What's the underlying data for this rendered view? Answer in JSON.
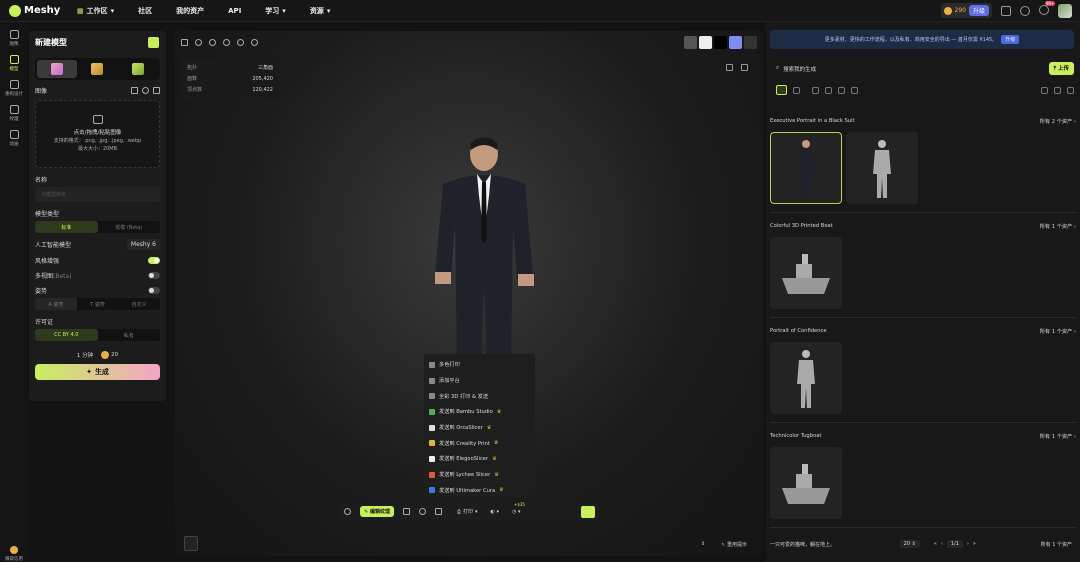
{
  "topbar": {
    "logo": "Meshy",
    "nav": [
      {
        "label": "工作区",
        "dropdown": true
      },
      {
        "label": "社区",
        "dropdown": false
      },
      {
        "label": "我的资产",
        "dropdown": false
      },
      {
        "label": "API",
        "dropdown": false
      },
      {
        "label": "学习",
        "dropdown": true
      },
      {
        "label": "资源",
        "dropdown": true
      }
    ],
    "credits": "290",
    "upgrade_label": "升级",
    "notification_badge": "99+"
  },
  "leftbar": {
    "items": [
      {
        "label": "图像",
        "icon": "image-icon"
      },
      {
        "label": "模型",
        "icon": "cube-icon",
        "active": true
      },
      {
        "label": "重构设计",
        "icon": "paint-icon"
      },
      {
        "label": "纹理",
        "icon": "texture-icon"
      },
      {
        "label": "动画",
        "icon": "run-icon"
      }
    ],
    "bottom_label": "赚取信用"
  },
  "panel": {
    "title": "新建模型",
    "image_label": "图像",
    "upload_text": "点击/拖拽/粘贴图像",
    "formats": "支持的格式：.png, .jpg, .jpeg, .webp",
    "max_size": "最大大小：20MB",
    "name_label": "名称",
    "name_placeholder": "为模型命名",
    "model_type_label": "模型类型",
    "model_types": [
      "标准",
      "低模 (Beta)"
    ],
    "ai_model_label": "人工智能模型",
    "ai_model_value": "Meshy 6",
    "style_enhance_label": "风格增强",
    "multiview_label": "多视图",
    "multiview_tag": "(Beta)",
    "pose_label": "姿势",
    "poses": [
      "A 姿势",
      "T 姿势",
      "自定义"
    ],
    "license_label": "许可证",
    "licenses": [
      "CC BY 4.0",
      "私有"
    ],
    "time": "1 分钟",
    "cost": "20",
    "generate_label": "生成"
  },
  "viewer": {
    "stats": [
      {
        "k": "拓扑",
        "v": "三角面"
      },
      {
        "k": "面数",
        "v": "205,420"
      },
      {
        "k": "顶点数",
        "v": "120,422"
      }
    ],
    "menu": [
      {
        "label": "多色打印",
        "crown": false
      },
      {
        "label": "添加平台",
        "crown": false
      },
      {
        "label": "全彩 3D 打印 & 发送",
        "crown": false
      },
      {
        "label": "发送到 Bambu Studio",
        "crown": true
      },
      {
        "label": "发送到 OrcaSlicer",
        "crown": true
      },
      {
        "label": "发送到 Creality Print",
        "crown": true
      },
      {
        "label": "发送到 ElegooSlicer",
        "crown": true
      },
      {
        "label": "发送到 Lychee Slicer",
        "crown": true
      },
      {
        "label": "发送到 Ultimaker Cura",
        "crown": true
      }
    ],
    "texture_button": "编辑纹理",
    "print_label": "打印",
    "badge": "+$35",
    "prompt_label": "重用提示"
  },
  "right": {
    "banner": "更多素材、更快的工作流程，以及私有、商用安全的导出 — 首月仅需 ¥145。",
    "banner_btn": "升级",
    "search_placeholder": "搜索我的生成",
    "upload_label": "上传",
    "groups": [
      {
        "title": "Executive Portrait in a Black Suit",
        "count": "所有 2 个资产",
        "n": 2,
        "kind": "person"
      },
      {
        "title": "Colorful 3D Printed Boat",
        "count": "所有 1 个资产",
        "n": 1,
        "kind": "boat"
      },
      {
        "title": "Portrait of Confidence",
        "count": "所有 1 个资产",
        "n": 1,
        "kind": "person"
      },
      {
        "title": "Technicolor Tugboat",
        "count": "所有 1 个资产",
        "n": 1,
        "kind": "boat"
      }
    ],
    "footer_text": "一只可爱的猫咪，躺在地上。",
    "page_size": "20",
    "page": "1/1",
    "footer_count": "所有 1 个资产"
  },
  "colors": {
    "accent": "#c9ef5e",
    "panel": "#1c1c1c",
    "background": "#121212",
    "upgrade": "#5f6ee6"
  }
}
